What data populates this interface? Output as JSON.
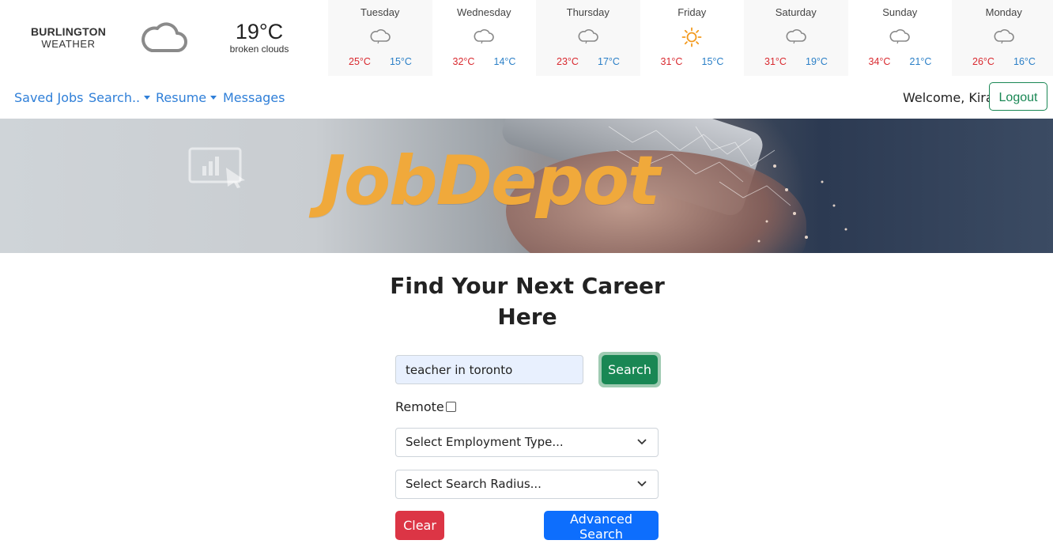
{
  "weather": {
    "city": "BURLINGTON",
    "label": "WEATHER",
    "current_icon": "cloud-icon",
    "current_temp": "19°C",
    "current_desc": "broken clouds",
    "days": [
      {
        "name": "Tuesday",
        "icon": "cloud-icon",
        "high": "25°C",
        "low": "15°C"
      },
      {
        "name": "Wednesday",
        "icon": "cloud-icon",
        "high": "32°C",
        "low": "14°C"
      },
      {
        "name": "Thursday",
        "icon": "cloud-icon",
        "high": "23°C",
        "low": "17°C"
      },
      {
        "name": "Friday",
        "icon": "sun-icon",
        "high": "31°C",
        "low": "15°C"
      },
      {
        "name": "Saturday",
        "icon": "cloud-icon",
        "high": "31°C",
        "low": "19°C"
      },
      {
        "name": "Sunday",
        "icon": "cloud-icon",
        "high": "34°C",
        "low": "21°C"
      },
      {
        "name": "Monday",
        "icon": "cloud-icon",
        "high": "26°C",
        "low": "16°C"
      }
    ]
  },
  "nav": {
    "saved_jobs": "Saved Jobs",
    "search": "Search..",
    "resume": "Resume",
    "messages": "Messages",
    "welcome": "Welcome, Kira",
    "logout": "Logout"
  },
  "banner": {
    "logo": "JobDepot"
  },
  "form": {
    "heading_line1": "Find Your Next Career",
    "heading_line2": "Here",
    "search_value": "teacher in toronto",
    "search_button": "Search",
    "remote_label": "Remote",
    "employment_select": "Select Employment Type...",
    "radius_select": "Select Search Radius...",
    "clear_button": "Clear",
    "advanced_button": "Advanced Search"
  },
  "colors": {
    "link": "#2f7fd8",
    "success": "#198754",
    "danger": "#dc3545",
    "primary": "#0d6efd",
    "logo": "#f0a93b",
    "temp_high": "#d9292f",
    "temp_low": "#2a7fc7"
  }
}
